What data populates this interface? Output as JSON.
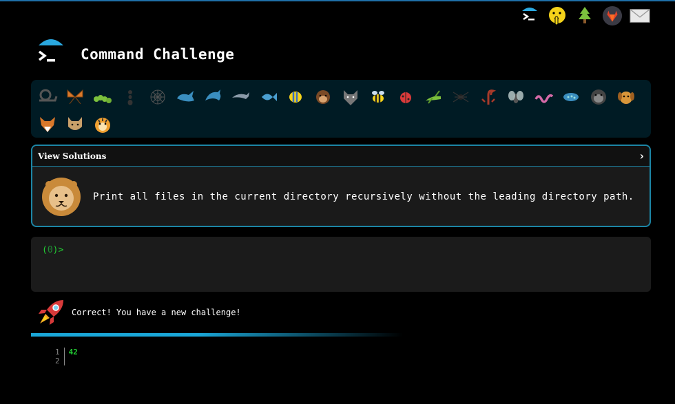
{
  "nav": {
    "icons": [
      "terminal-icon",
      "shushing-face-icon",
      "tree-icon",
      "gitlab-icon",
      "mail-icon"
    ]
  },
  "header": {
    "title": "Command Challenge"
  },
  "animals": [
    "snail",
    "butterfly",
    "caterpillar",
    "ant",
    "spider-web",
    "whale",
    "dolphin-blue",
    "dolphin-grey",
    "fish",
    "tropical-fish",
    "monkey-head",
    "wolf",
    "bee",
    "ladybug",
    "cricket",
    "spider",
    "scorpion",
    "fly",
    "worm",
    "microbe",
    "gorilla",
    "dog",
    "fox",
    "cat",
    "tiger"
  ],
  "challenge": {
    "header_label": "View Solutions",
    "chevron": "›",
    "description": "Print all files in the current directory recursively without the leading directory path."
  },
  "terminal": {
    "prompt_open": "(",
    "prompt_num": "0",
    "prompt_close": ")>"
  },
  "success": {
    "message": "Correct! You have a new challenge!"
  },
  "output": {
    "line_numbers": [
      "1",
      "2"
    ],
    "lines": [
      "42",
      ""
    ]
  },
  "colors": {
    "accent": "#1c86a6",
    "prompt": "#22cc33",
    "bar": "#1aa7d8"
  }
}
